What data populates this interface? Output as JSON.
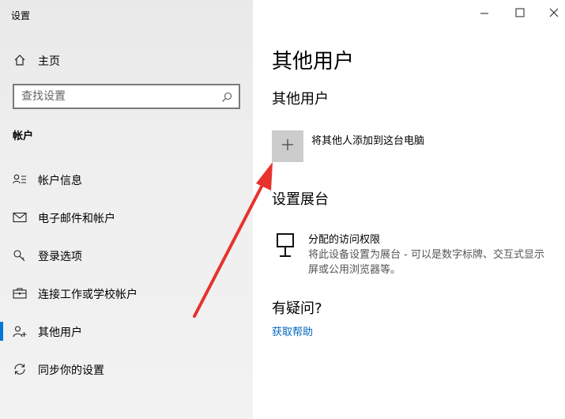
{
  "window": {
    "title": "设置"
  },
  "sidebar": {
    "home_label": "主页",
    "search_placeholder": "查找设置",
    "section_title": "帐户",
    "items": [
      {
        "label": "帐户信息",
        "icon": "person-list-icon"
      },
      {
        "label": "电子邮件和帐户",
        "icon": "mail-icon"
      },
      {
        "label": "登录选项",
        "icon": "key-icon"
      },
      {
        "label": "连接工作或学校帐户",
        "icon": "briefcase-icon"
      },
      {
        "label": "其他用户",
        "icon": "person-add-icon",
        "active": true
      },
      {
        "label": "同步你的设置",
        "icon": "sync-icon"
      }
    ]
  },
  "main": {
    "title": "其他用户",
    "other_users": {
      "heading": "其他用户",
      "add_label": "将其他人添加到这台电脑"
    },
    "kiosk": {
      "heading": "设置展台",
      "item_title": "分配的访问权限",
      "item_desc": "将此设备设置为展台 - 可以是数字标牌、交互式显示屏或公用浏览器等。"
    },
    "help": {
      "heading": "有疑问?",
      "link": "获取帮助"
    }
  },
  "colors": {
    "accent": "#0078d7",
    "link": "#0067c0",
    "annotation_arrow": "#e8322e"
  }
}
